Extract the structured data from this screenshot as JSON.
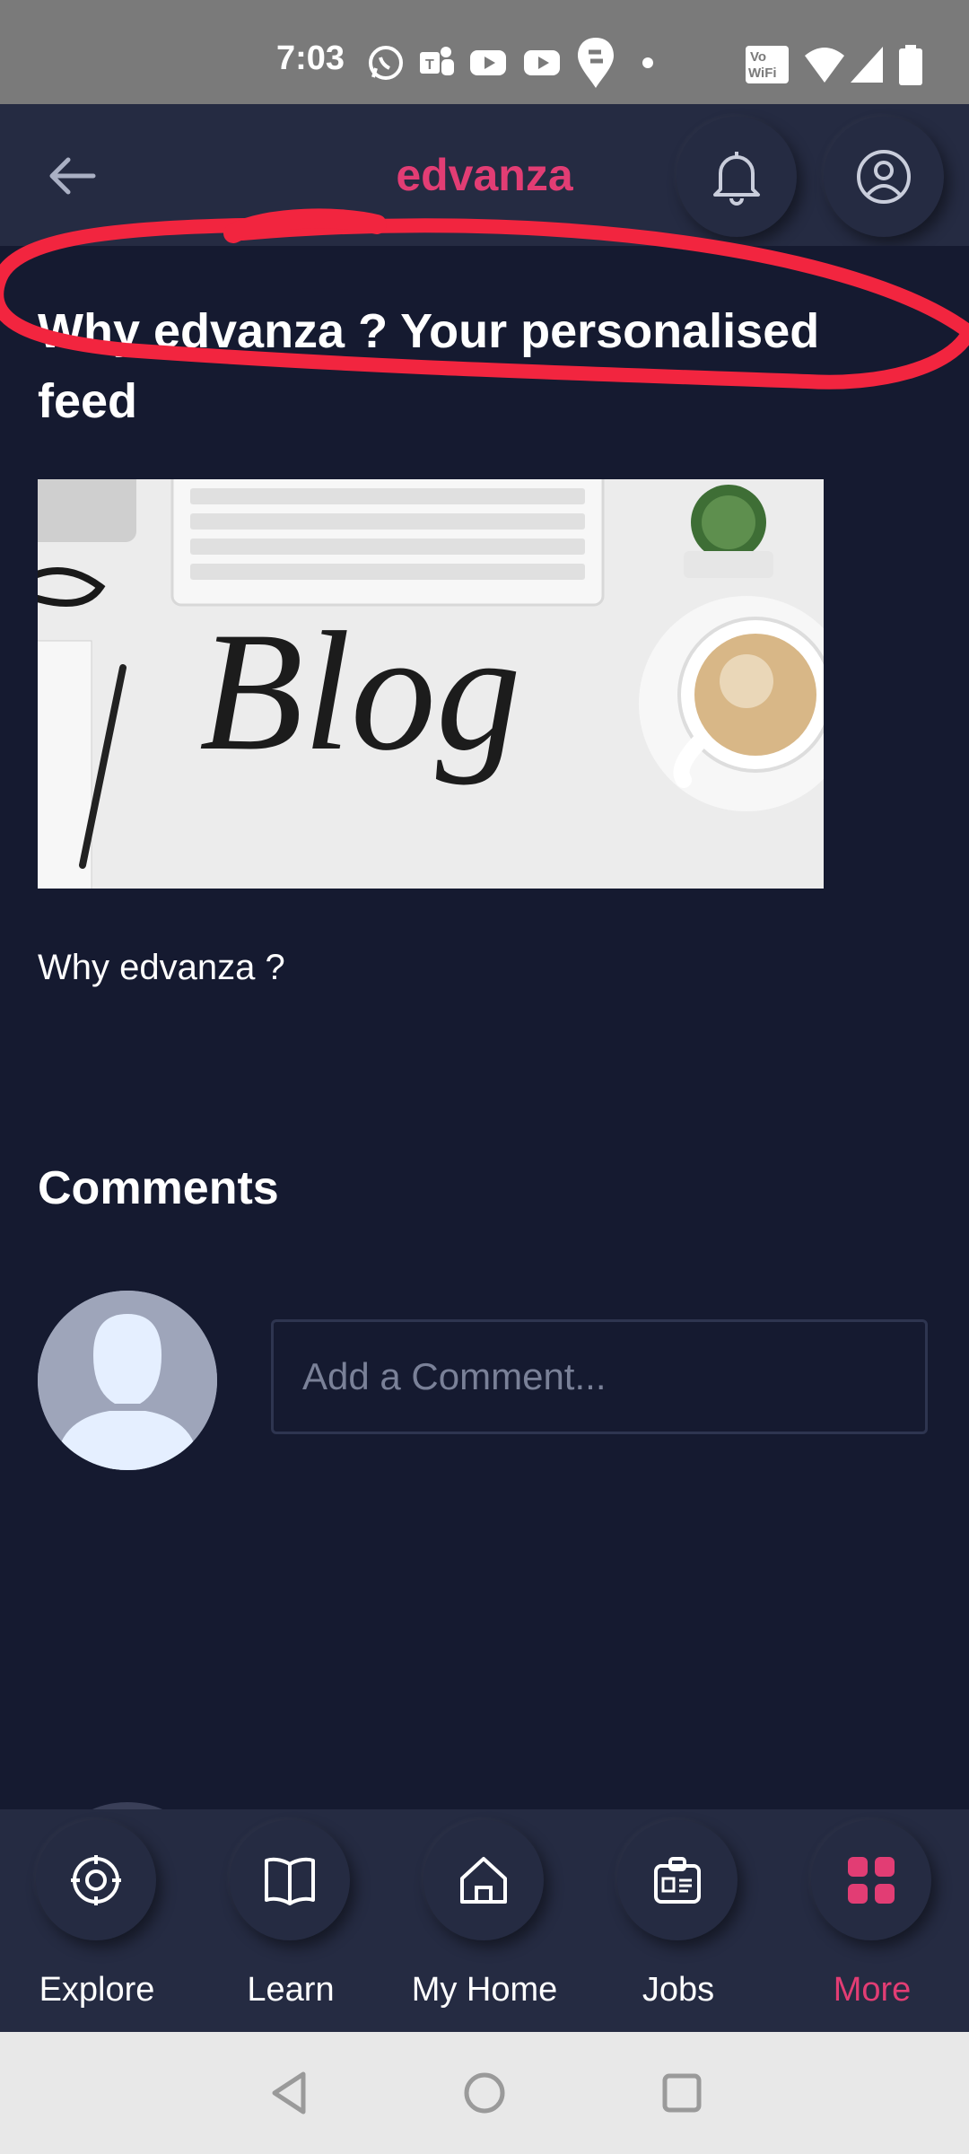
{
  "status_bar": {
    "time": "7:03",
    "icons": [
      "whatsapp-icon",
      "teams-icon",
      "youtube-icon",
      "youtube-icon",
      "swiggy-icon",
      "dot-icon"
    ],
    "right_icons": [
      "vowifi-icon",
      "wifi-icon",
      "signal-icon",
      "battery-icon"
    ],
    "vowifi_text": "Vo WiFi"
  },
  "app_bar": {
    "title": "edvanza",
    "accent_color": "#e23d74"
  },
  "post": {
    "title": "Why edvanza ? Your personalised feed",
    "image_alt": "Blog",
    "text": "Why edvanza ?"
  },
  "comments": {
    "heading": "Comments",
    "input_placeholder": "Add a Comment..."
  },
  "bottom_nav": {
    "items": [
      {
        "label": "Explore",
        "icon": "compass-icon"
      },
      {
        "label": "Learn",
        "icon": "book-icon"
      },
      {
        "label": "My Home",
        "icon": "home-icon"
      },
      {
        "label": "Jobs",
        "icon": "id-badge-icon"
      },
      {
        "label": "More",
        "icon": "grid-icon",
        "active": true
      }
    ]
  },
  "system_nav": {
    "buttons": [
      "back-triangle-icon",
      "home-circle-icon",
      "recents-square-icon"
    ]
  }
}
